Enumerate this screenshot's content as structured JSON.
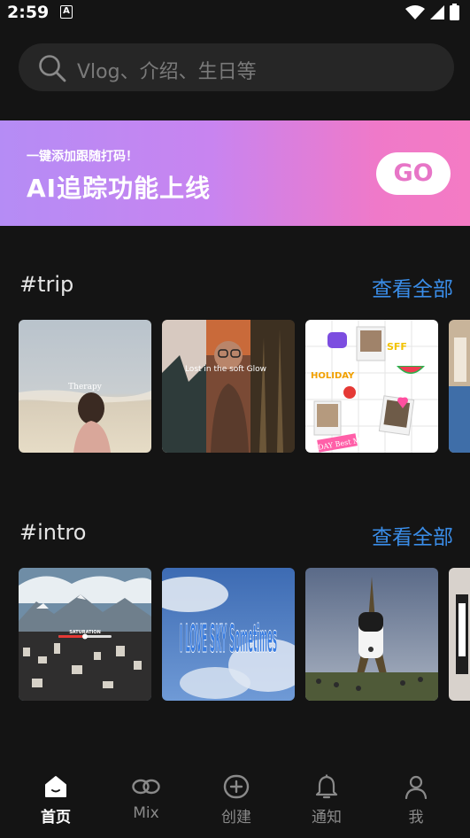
{
  "status": {
    "time": "2:59",
    "notification_icon": "A"
  },
  "search": {
    "placeholder": "Vlog、介绍、生日等"
  },
  "banner": {
    "subtitle": "一键添加跟随打码！",
    "title": "AI追踪功能上线",
    "button_label": "GO"
  },
  "sections": [
    {
      "title": "#trip",
      "view_all": "查看全部",
      "thumbs": [
        {
          "caption": "Therapy"
        },
        {
          "caption": "Lost in the soft Glow"
        },
        {
          "caption": "HOLIDAY Best Month"
        }
      ]
    },
    {
      "title": "#intro",
      "view_all": "查看全部",
      "thumbs": [
        {
          "caption": "SATURATION"
        },
        {
          "caption": "I LOVE SKY Sometimes"
        },
        {
          "caption": ""
        }
      ]
    }
  ],
  "tabs": [
    {
      "label": "首页",
      "icon": "home-icon",
      "active": true
    },
    {
      "label": "Mix",
      "icon": "link-icon",
      "active": false
    },
    {
      "label": "创建",
      "icon": "add-circle-icon",
      "active": false
    },
    {
      "label": "通知",
      "icon": "bell-icon",
      "active": false
    },
    {
      "label": "我",
      "icon": "profile-icon",
      "active": false
    }
  ]
}
